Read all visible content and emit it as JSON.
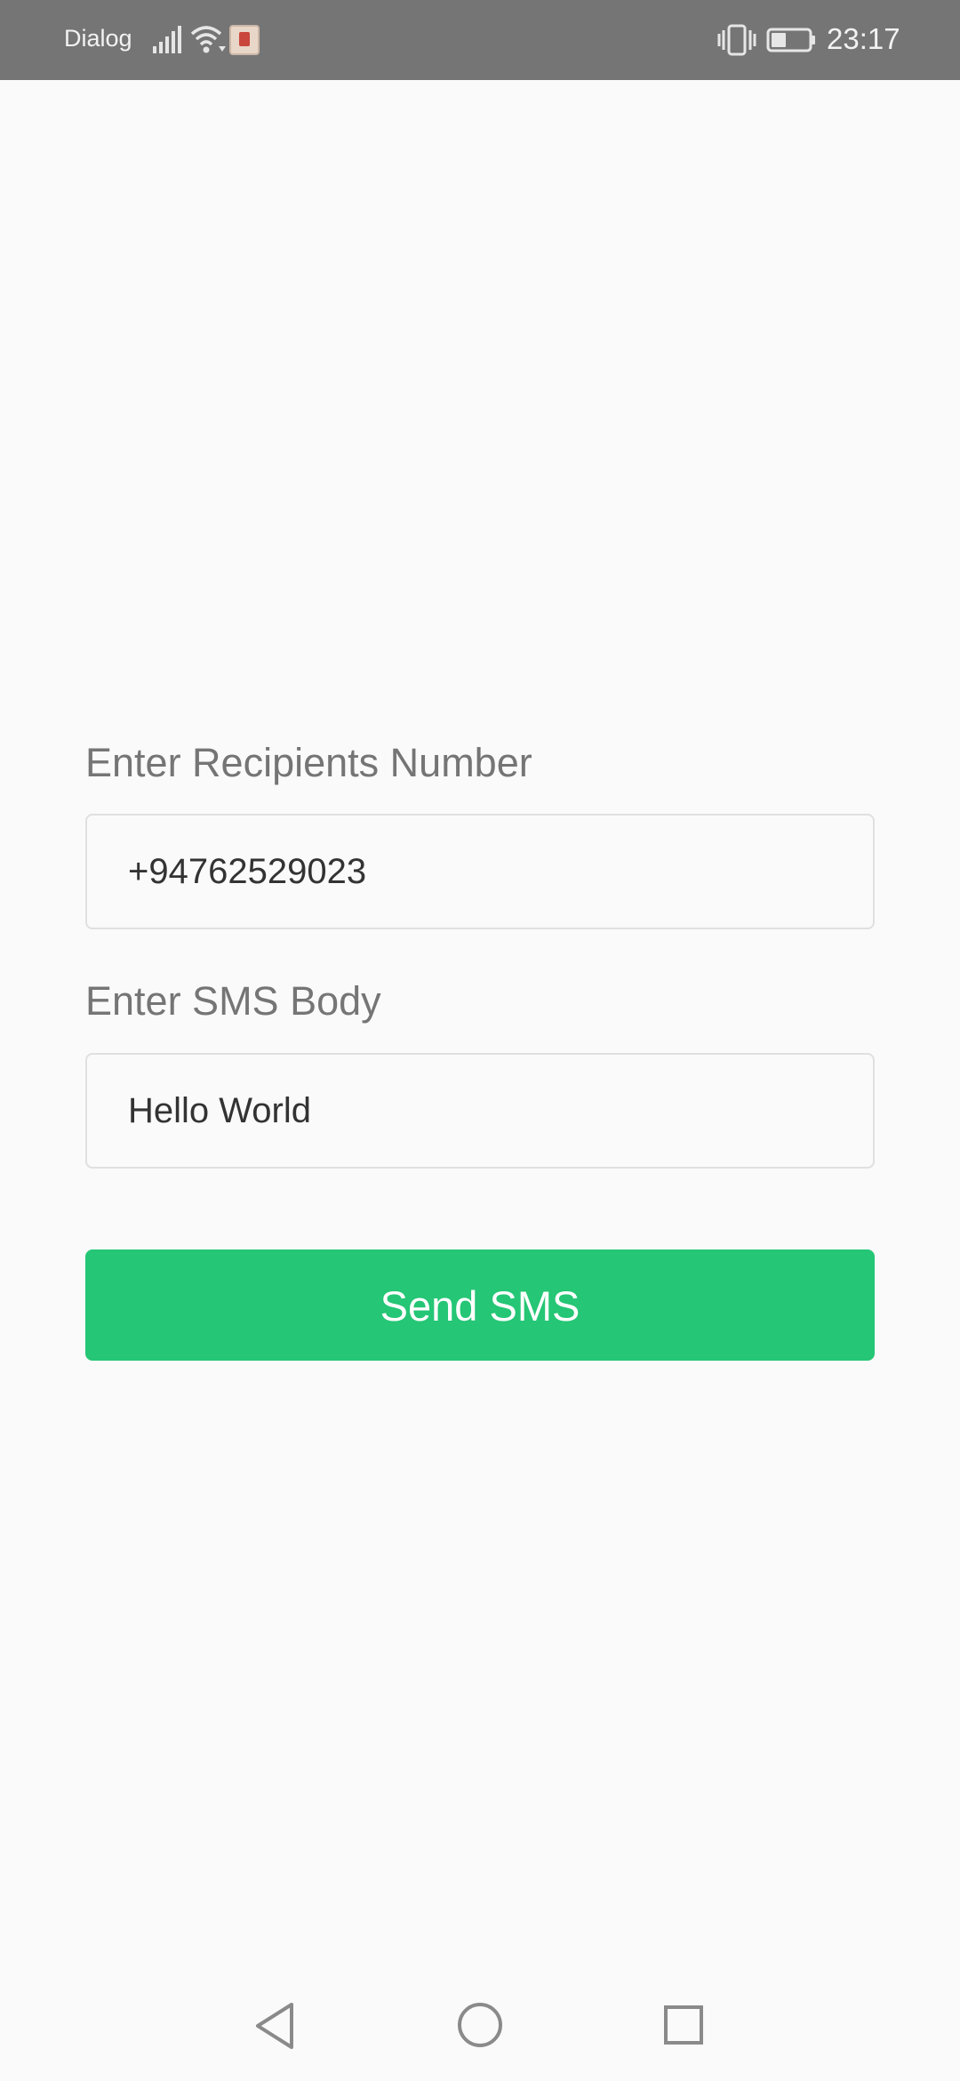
{
  "status_bar": {
    "carrier": "Dialog",
    "time": "23:17",
    "icons": [
      "signal-icon",
      "wifi-icon",
      "app-notification-icon",
      "vibrate-icon",
      "battery-icon"
    ]
  },
  "form": {
    "number_label": "Enter Recipients Number",
    "number_value": "+94762529023",
    "body_label": "Enter SMS Body",
    "body_value": "Hello World",
    "send_label": "Send SMS"
  },
  "nav_bar": {
    "icons": [
      "back-icon",
      "home-icon",
      "recents-icon"
    ]
  },
  "colors": {
    "status_bar": "#757575",
    "background": "#fafafa",
    "accent": "#25c675",
    "label_text": "#757575",
    "input_border": "#e0e0e0"
  }
}
